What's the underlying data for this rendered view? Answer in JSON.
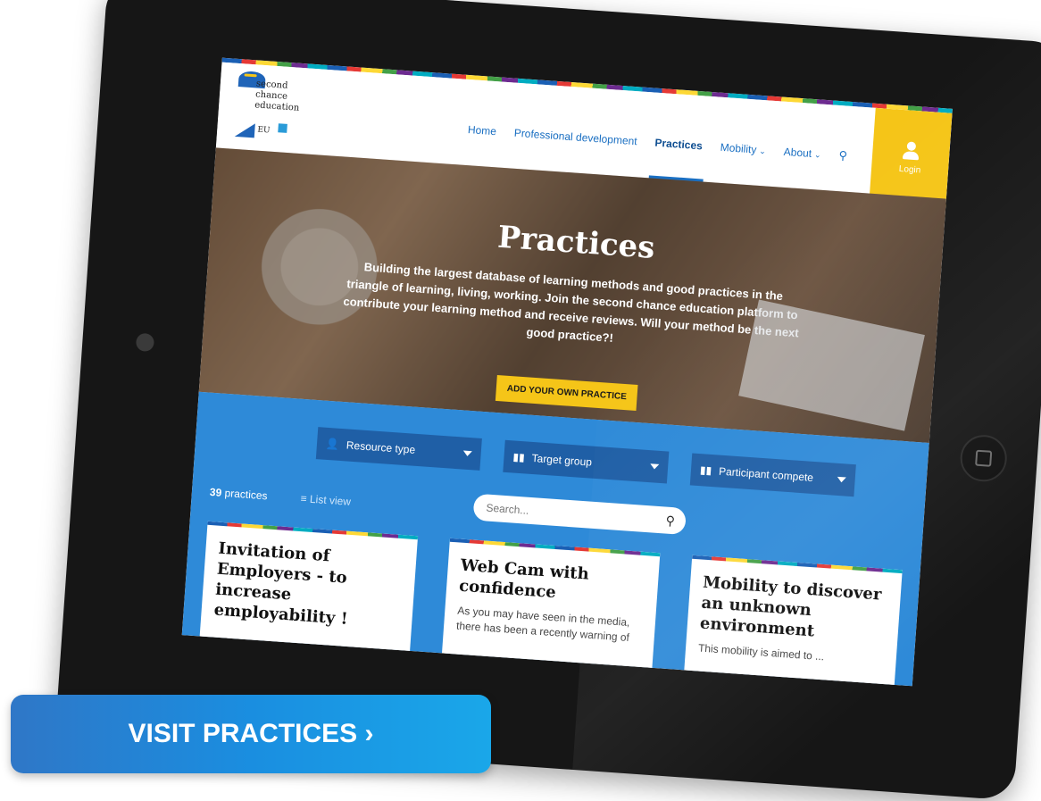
{
  "logo": {
    "line1": "second",
    "line2": "chance",
    "line3": "education",
    "line4": "EU"
  },
  "nav": {
    "items": [
      {
        "label": "Home"
      },
      {
        "label": "Professional development"
      },
      {
        "label": "Practices"
      },
      {
        "label": "Mobility"
      },
      {
        "label": "About"
      }
    ],
    "login_label": "Login"
  },
  "hero": {
    "title": "Practices",
    "description": "Building the largest database of learning methods and good practices in the triangle of learning, living, working. Join the second chance education platform to contribute your learning method and receive reviews. Will your method be the next good practice?!",
    "cta_label": "ADD YOUR OWN PRACTICE"
  },
  "filters": {
    "resource_type": "Resource type",
    "target_group": "Target group",
    "participant_comp": "Participant compete",
    "search_placeholder": "Search...",
    "count_number": "39",
    "count_label": "practices",
    "list_view_label": "List view"
  },
  "cards": [
    {
      "title": "Invitation of Employers - to increase employability !",
      "excerpt": ""
    },
    {
      "title": "Web Cam with confidence",
      "excerpt": "As you may have seen in the media, there has been a recently warning of"
    },
    {
      "title": "Mobility to discover an unknown environment",
      "excerpt": "This mobility is aimed to ..."
    }
  ],
  "visit_button": "VISIT PRACTICES ›",
  "colors": {
    "primary_blue": "#2e8ad8",
    "dark_blue": "#1f5fa6",
    "yellow": "#f5c518",
    "frame": "#161616"
  }
}
